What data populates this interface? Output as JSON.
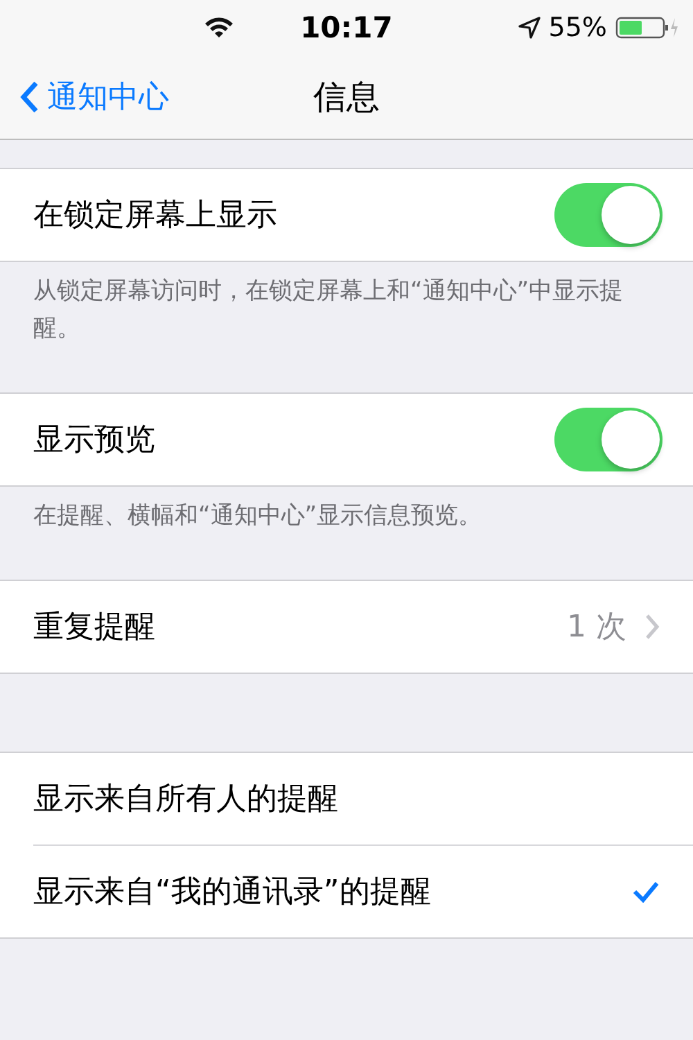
{
  "status_bar": {
    "time": "10:17",
    "battery": "55%"
  },
  "nav": {
    "back": "通知中心",
    "title": "信息"
  },
  "sections": [
    {
      "rows": [
        {
          "kind": "toggle",
          "label": "在锁定屏幕上显示",
          "on": true
        }
      ],
      "footer": "从锁定屏幕访问时，在锁定屏幕上和“通知中心”中显示提醒。"
    },
    {
      "rows": [
        {
          "kind": "toggle",
          "label": "显示预览",
          "on": true
        }
      ],
      "footer": "在提醒、横幅和“通知中心”显示信息预览。"
    },
    {
      "rows": [
        {
          "kind": "detail",
          "label": "重复提醒",
          "value": "1 次"
        }
      ]
    },
    {
      "rows": [
        {
          "kind": "check",
          "label": "显示来自所有人的提醒",
          "selected": false
        },
        {
          "kind": "check",
          "label": "显示来自“我的通讯录”的提醒",
          "selected": true
        }
      ]
    }
  ]
}
